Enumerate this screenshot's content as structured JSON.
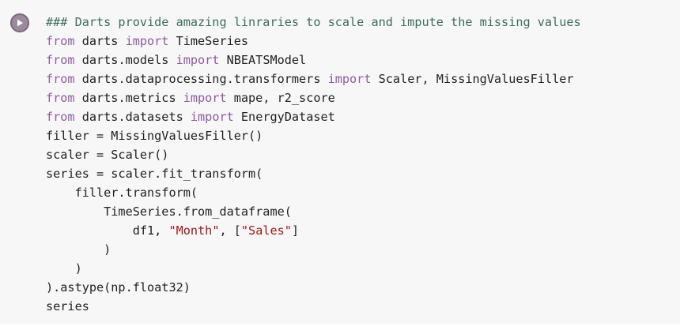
{
  "cell": {
    "run_button_label": "Run cell",
    "code_lines": [
      [
        {
          "t": "### Darts provide amazing linraries to scale and impute the missing values",
          "k": "comment"
        }
      ],
      [
        {
          "t": "from",
          "k": "keyword"
        },
        {
          "t": " darts ",
          "k": "plain"
        },
        {
          "t": "import",
          "k": "keyword"
        },
        {
          "t": " TimeSeries",
          "k": "plain"
        }
      ],
      [
        {
          "t": "from",
          "k": "keyword"
        },
        {
          "t": " darts.models ",
          "k": "plain"
        },
        {
          "t": "import",
          "k": "keyword"
        },
        {
          "t": " NBEATSModel",
          "k": "plain"
        }
      ],
      [
        {
          "t": "from",
          "k": "keyword"
        },
        {
          "t": " darts.dataprocessing.transformers ",
          "k": "plain"
        },
        {
          "t": "import",
          "k": "keyword"
        },
        {
          "t": " Scaler, MissingValuesFiller",
          "k": "plain"
        }
      ],
      [
        {
          "t": "from",
          "k": "keyword"
        },
        {
          "t": " darts.metrics ",
          "k": "plain"
        },
        {
          "t": "import",
          "k": "keyword"
        },
        {
          "t": " mape, r2_score",
          "k": "plain"
        }
      ],
      [
        {
          "t": "from",
          "k": "keyword"
        },
        {
          "t": " darts.datasets ",
          "k": "plain"
        },
        {
          "t": "import",
          "k": "keyword"
        },
        {
          "t": " EnergyDataset",
          "k": "plain"
        }
      ],
      [
        {
          "t": "filler = MissingValuesFiller()",
          "k": "plain"
        }
      ],
      [
        {
          "t": "scaler = Scaler()",
          "k": "plain"
        }
      ],
      [
        {
          "t": "series = scaler.fit_transform(",
          "k": "plain"
        }
      ],
      [
        {
          "t": "    filler.transform(",
          "k": "plain"
        }
      ],
      [
        {
          "t": "        TimeSeries.from_dataframe(",
          "k": "plain"
        }
      ],
      [
        {
          "t": "            df1, ",
          "k": "plain"
        },
        {
          "t": "\"Month\"",
          "k": "string"
        },
        {
          "t": ", [",
          "k": "plain"
        },
        {
          "t": "\"Sales\"",
          "k": "string"
        },
        {
          "t": "]",
          "k": "plain"
        }
      ],
      [
        {
          "t": "        )",
          "k": "plain"
        }
      ],
      [
        {
          "t": "    )",
          "k": "plain"
        }
      ],
      [
        {
          "t": ").astype(np.float32)",
          "k": "plain"
        }
      ],
      [
        {
          "t": "series",
          "k": "plain"
        }
      ]
    ]
  },
  "colors": {
    "comment": "#3a6f5c",
    "keyword": "#8e5b9e",
    "string": "#a31515",
    "plain": "#212121",
    "cell_background": "#f7f7f7",
    "run_button": "#9b8a9b"
  }
}
